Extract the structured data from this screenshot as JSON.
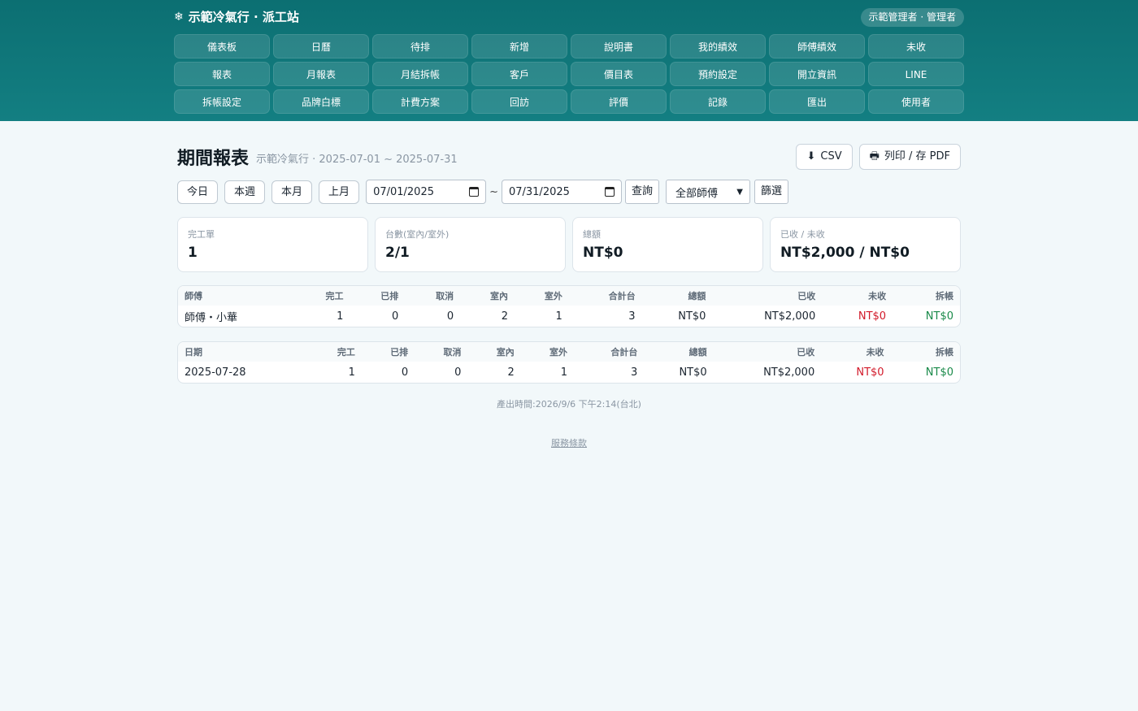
{
  "header": {
    "brand_icon": "❄",
    "brand": "示範冷氣行 · 派工站",
    "user": "示範管理者 · 管理者"
  },
  "nav": [
    "儀表板",
    "日曆",
    "待排",
    "新增",
    "說明書",
    "我的績效",
    "師傅績效",
    "未收",
    "報表",
    "月報表",
    "月結拆帳",
    "客戶",
    "價目表",
    "預約設定",
    "開立資訊",
    "LINE",
    "拆帳設定",
    "品牌白標",
    "計費方案",
    "回訪",
    "評價",
    "記錄",
    "匯出",
    "使用者"
  ],
  "page": {
    "title": "期間報表",
    "subtitle": "示範冷氣行 · 2025-07-01 ~ 2025-07-31",
    "csv_label": "CSV",
    "print_label": "列印 / 存 PDF"
  },
  "filters": {
    "today": "今日",
    "this_week": "本週",
    "this_month": "本月",
    "last_month": "上月",
    "date_from": "07/01/2025",
    "tilde": "~",
    "date_to": "07/31/2025",
    "query": "查詢",
    "tech_select": "全部師傅",
    "filter": "篩選"
  },
  "cards": [
    {
      "label": "完工單",
      "value": "1"
    },
    {
      "label": "台數(室內/室外)",
      "value": "2/1"
    },
    {
      "label": "總額",
      "value": "NT$0"
    },
    {
      "label": "已收 / 未收",
      "value": "NT$2,000 / NT$0"
    }
  ],
  "tech_table": {
    "headers": [
      "師傅",
      "完工",
      "已排",
      "取消",
      "室內",
      "室外",
      "合計台",
      "總額",
      "已收",
      "未收",
      "拆帳"
    ],
    "rows": [
      [
        "師傅・小華",
        "1",
        "0",
        "0",
        "2",
        "1",
        "3",
        "NT$0",
        "NT$2,000",
        "NT$0",
        "NT$0"
      ]
    ]
  },
  "date_table": {
    "headers": [
      "日期",
      "完工",
      "已排",
      "取消",
      "室內",
      "室外",
      "合計台",
      "總額",
      "已收",
      "未收",
      "拆帳"
    ],
    "rows": [
      [
        "2025-07-28",
        "1",
        "0",
        "0",
        "2",
        "1",
        "3",
        "NT$0",
        "NT$2,000",
        "NT$0",
        "NT$0"
      ]
    ]
  },
  "footer": {
    "generated": "產出時間:2026/9/6 下午2:14(台北)",
    "terms": "服務條款"
  },
  "colors": {
    "header_bg": "#0c6f72",
    "negative": "#d21a2a",
    "positive": "#1a8a4a"
  }
}
